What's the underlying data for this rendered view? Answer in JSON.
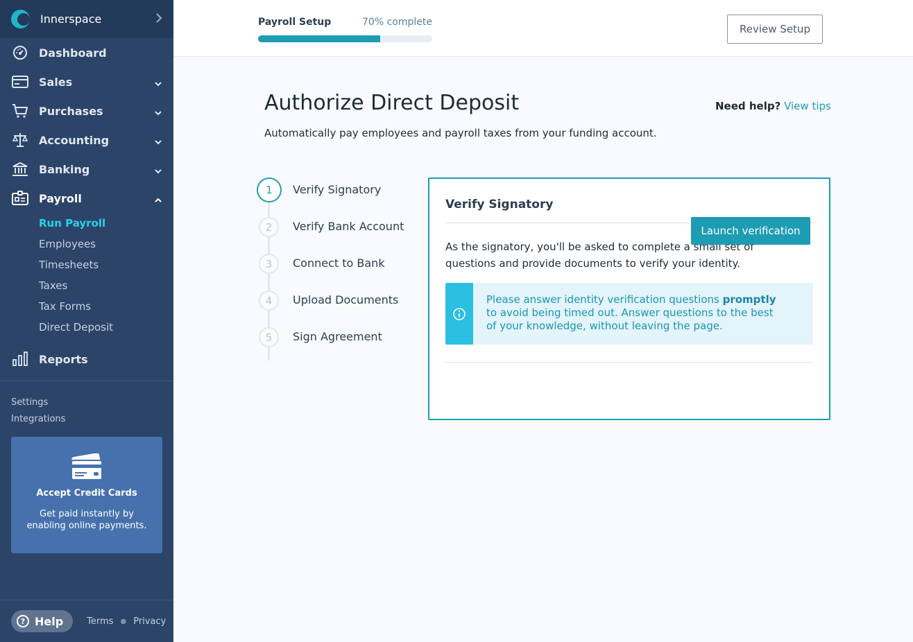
{
  "sidebar": {
    "brand": "Innerspace",
    "nav": [
      {
        "label": "Dashboard"
      },
      {
        "label": "Sales"
      },
      {
        "label": "Purchases"
      },
      {
        "label": "Accounting"
      },
      {
        "label": "Banking"
      },
      {
        "label": "Payroll"
      }
    ],
    "payroll_sub": [
      "Run Payroll",
      "Employees",
      "Timesheets",
      "Taxes",
      "Tax Forms",
      "Direct Deposit"
    ],
    "reports": "Reports",
    "links": [
      "Settings",
      "Integrations"
    ],
    "promo": {
      "title": "Accept Credit Cards",
      "text": "Get paid instantly by enabling online payments."
    },
    "footer": {
      "help": "Help",
      "terms": "Terms",
      "privacy": "Privacy"
    }
  },
  "topbar": {
    "progress_title": "Payroll Setup",
    "progress_text": "70% complete",
    "progress_value": 0.7,
    "review_button": "Review Setup"
  },
  "main": {
    "title": "Authorize Direct Deposit",
    "subtitle": "Automatically pay employees and payroll taxes from your funding account.",
    "need_help": "Need help?",
    "view_tips": "View tips",
    "steps": [
      {
        "num": "1",
        "label": "Verify Signatory"
      },
      {
        "num": "2",
        "label": "Verify Bank Account"
      },
      {
        "num": "3",
        "label": "Connect to Bank"
      },
      {
        "num": "4",
        "label": "Upload Documents"
      },
      {
        "num": "5",
        "label": "Sign Agreement"
      }
    ],
    "card": {
      "title": "Verify Signatory",
      "text": "As the signatory, you'll be asked to complete a small set of questions and provide documents to verify your identity.",
      "info_pre": "Please answer identity verification questions ",
      "info_bold": "promptly",
      "info_post": " to avoid being timed out. Answer questions to the best of your knowledge, without leaving the page.",
      "button": "Launch verification"
    }
  },
  "colors": {
    "sidebar_bg": "#2c4468",
    "accent": "#1d9cb3",
    "active_sub": "#2ad0ea",
    "promo_bg": "#4671ad"
  }
}
